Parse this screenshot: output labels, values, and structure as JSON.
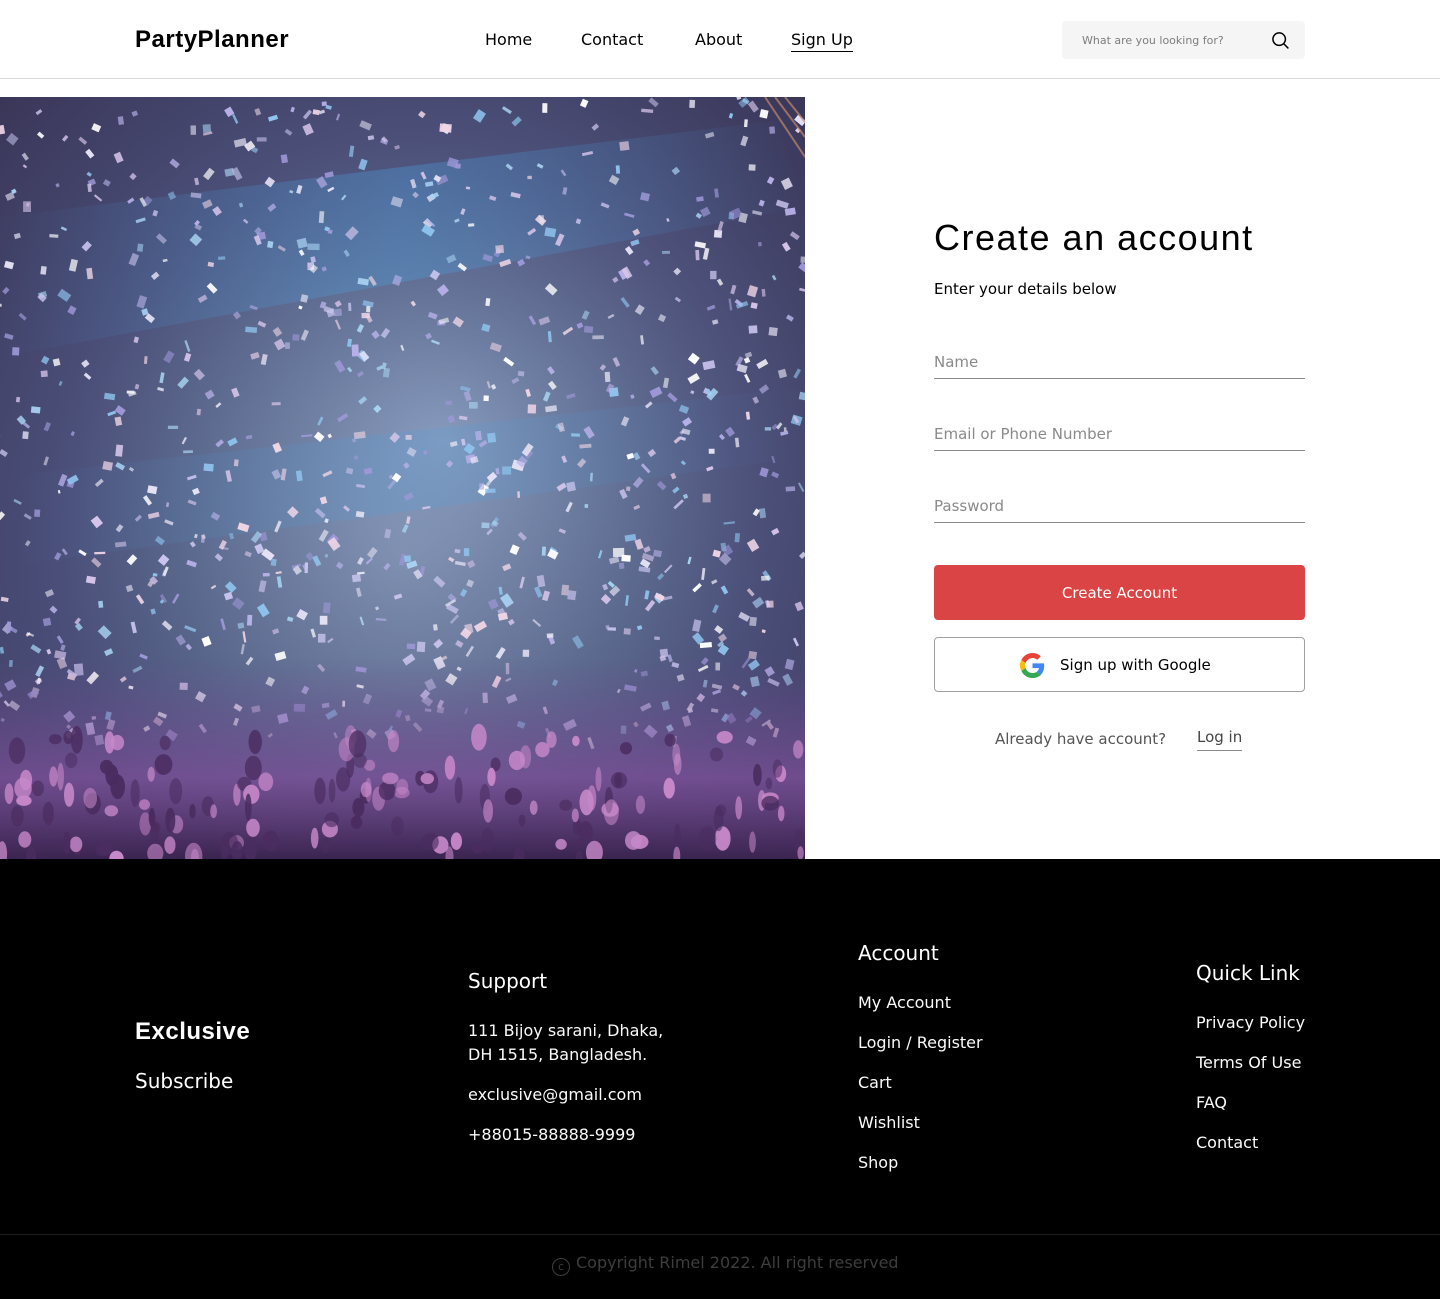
{
  "header": {
    "logo": "PartyPlanner",
    "nav": [
      "Home",
      "Contact",
      "About",
      "Sign Up"
    ],
    "active_nav": "Sign Up",
    "search_placeholder": "What are you looking for?"
  },
  "form": {
    "title": "Create an account",
    "subtitle": "Enter your details below",
    "name_placeholder": "Name",
    "email_placeholder": "Email or Phone Number",
    "password_placeholder": "Password",
    "create_button": "Create Account",
    "google_button": "Sign up with Google",
    "already_text": "Already have account?",
    "login_link": "Log in"
  },
  "footer": {
    "brand": "Exclusive",
    "subscribe": "Subscribe",
    "support": {
      "heading": "Support",
      "address_line1": "111 Bijoy sarani, Dhaka,",
      "address_line2": "DH 1515, Bangladesh.",
      "email": "exclusive@gmail.com",
      "phone": "+88015-88888-9999"
    },
    "account": {
      "heading": "Account",
      "links": [
        "My Account",
        "Login / Register",
        "Cart",
        "Wishlist",
        "Shop"
      ]
    },
    "quick_link": {
      "heading": "Quick Link",
      "links": [
        "Privacy Policy",
        "Terms Of Use",
        "FAQ",
        "Contact"
      ]
    },
    "copyright": "Copyright Rimel 2022. All right reserved"
  },
  "colors": {
    "accent": "#db4444",
    "footer_bg": "#000000",
    "search_bg": "#f5f5f5"
  }
}
